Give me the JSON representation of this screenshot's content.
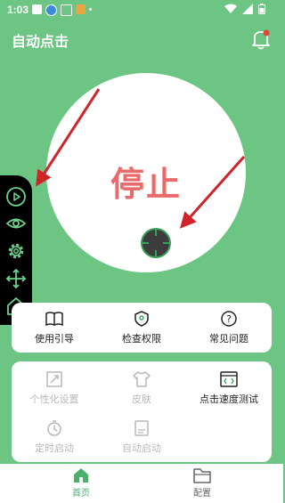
{
  "status_bar": {
    "time": "1:03"
  },
  "app": {
    "title": "自动点击"
  },
  "main": {
    "stop_label": "停止"
  },
  "features": [
    {
      "label": "使用引导",
      "icon": "book-icon"
    },
    {
      "label": "检查权限",
      "icon": "shield-icon"
    },
    {
      "label": "常见问题",
      "icon": "question-icon"
    }
  ],
  "settings": [
    {
      "label": "个性化设置",
      "icon": "edit-icon",
      "enabled": false
    },
    {
      "label": "皮肤",
      "icon": "tshirt-icon",
      "enabled": false
    },
    {
      "label": "点击速度测试",
      "icon": "code-window-icon",
      "enabled": true
    },
    {
      "label": "定时启动",
      "icon": "timer-icon",
      "enabled": false
    },
    {
      "label": "自动启动",
      "icon": "app-icon",
      "enabled": false
    }
  ],
  "nav": {
    "home_label": "首页",
    "config_label": "配置"
  },
  "colors": {
    "background": "#6cc583",
    "stop_text": "#e86a6a",
    "accent": "#4caf6d",
    "arrow": "#d0232a"
  }
}
